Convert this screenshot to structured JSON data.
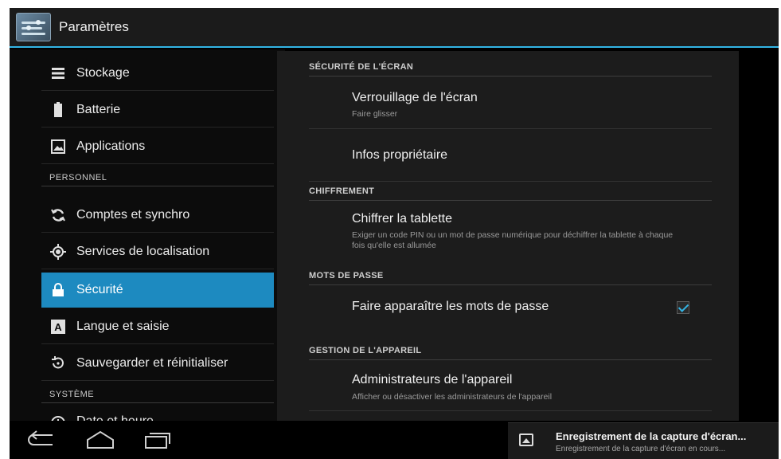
{
  "actionbar": {
    "title": "Paramètres"
  },
  "left": {
    "items_top": [
      {
        "label": "Stockage",
        "icon": "storage-icon"
      },
      {
        "label": "Batterie",
        "icon": "battery-icon"
      },
      {
        "label": "Applications",
        "icon": "apps-icon"
      }
    ],
    "section_personal": "PERSONNEL",
    "items_personal": [
      {
        "label": "Comptes et synchro",
        "icon": "sync-icon"
      },
      {
        "label": "Services de localisation",
        "icon": "location-icon"
      },
      {
        "label": "Sécurité",
        "icon": "lock-icon",
        "selected": true
      },
      {
        "label": "Langue et saisie",
        "icon": "language-icon"
      },
      {
        "label": "Sauvegarder et réinitialiser",
        "icon": "backup-icon"
      }
    ],
    "section_system": "SYSTÈME",
    "items_system": [
      {
        "label": "Date et heure",
        "icon": "clock-icon"
      }
    ]
  },
  "right": {
    "section_screen": "SÉCURITÉ DE L'ÉCRAN",
    "screen_lock_title": "Verrouillage de l'écran",
    "screen_lock_summary": "Faire glisser",
    "owner_info_title": "Infos propriétaire",
    "section_encryption": "CHIFFREMENT",
    "encrypt_title": "Chiffrer la tablette",
    "encrypt_summary": "Exiger un code PIN ou un mot de passe numérique pour déchiffrer la tablette à chaque fois qu'elle est allumée",
    "section_passwords": "MOTS DE PASSE",
    "show_passwords_title": "Faire apparaître les mots de passe",
    "show_passwords_checked": true,
    "section_device_admin": "GESTION DE L'APPAREIL",
    "device_admins_title": "Administrateurs de l'appareil",
    "device_admins_summary": "Afficher ou désactiver les administrateurs de l'appareil"
  },
  "notification": {
    "title": "Enregistrement de la capture d'écran...",
    "text": "Enregistrement de la capture d'écran en cours..."
  },
  "colors": {
    "accent": "#33b5e5",
    "selected": "#1d8ac0"
  }
}
